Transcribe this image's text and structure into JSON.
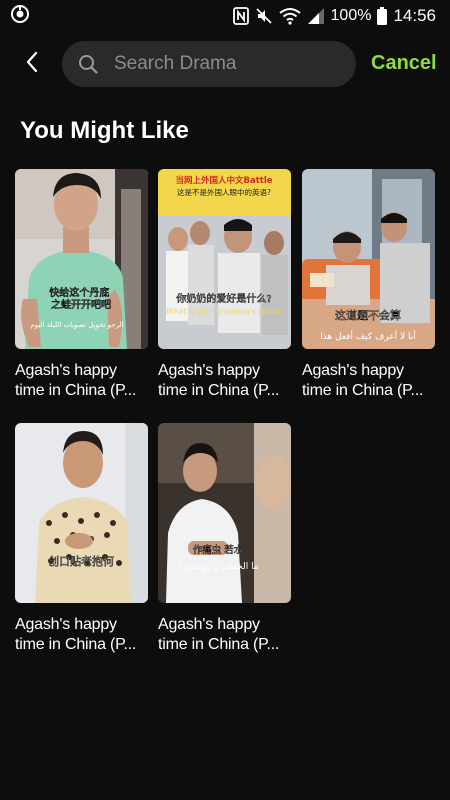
{
  "status_bar": {
    "time": "14:56",
    "battery_percent": "100%",
    "icons": [
      "app-notification-icon",
      "nfc-icon",
      "mute-icon",
      "wifi-icon",
      "signal-icon",
      "battery-icon"
    ]
  },
  "search": {
    "placeholder": "Search Drama",
    "value": "",
    "cancel_label": "Cancel"
  },
  "section": {
    "title": "You Might Like"
  },
  "cards": [
    {
      "title": "Agash's happy\ntime in China (P...",
      "caption_cn": "快给这个丹底\n之蛙开开吧吧",
      "caption_ar": "الرجو تحويل تصويات الليلة اليوم"
    },
    {
      "title": "Agash's happy\ntime in China (P...",
      "caption_top": "当网上外国人中文Battle\n这是不是外国人眼中的英语?",
      "caption_cn": "你奶奶的爱好是什么?",
      "caption_en": "What is your grandma's hobby"
    },
    {
      "title": "Agash's happy\ntime in China (P...",
      "caption_cn": "这道题不会算",
      "caption_ar": "أنا لا أعرف كيف أفعل هذا"
    },
    {
      "title": "Agash's happy\ntime in China (P...",
      "caption_cn": "创口贴老抱何"
    },
    {
      "title": "Agash's happy\ntime in China (P...",
      "caption_cn": "作痛虫 若水",
      "caption_ar": "ما الخطب يا روشوي؟"
    }
  ],
  "colors": {
    "background": "#0d0d0d",
    "search_bg": "#2a2a2a",
    "accent": "#8fdc3a"
  }
}
